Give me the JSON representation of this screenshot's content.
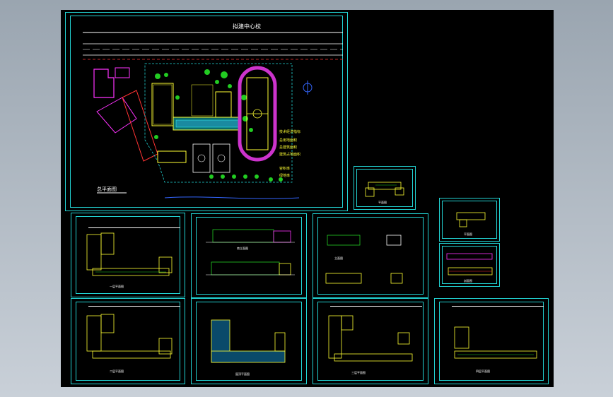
{
  "site_plan": {
    "title": "拟建中心校",
    "caption": "总平面图",
    "notes": [
      "技术经济指标",
      "总用地面积",
      "总建筑面积",
      "建筑占地面积",
      "容积率",
      "绿地率"
    ]
  },
  "sheets": [
    {
      "id": "first-floor-plan",
      "caption": "一层平面图"
    },
    {
      "id": "front-elevation",
      "caption": "南立面图"
    },
    {
      "id": "side-elevations",
      "caption": "立面图"
    },
    {
      "id": "small-plan-a",
      "caption": "平面图"
    },
    {
      "id": "small-plan-b",
      "caption": "平面图"
    },
    {
      "id": "small-section",
      "caption": "剖面图"
    },
    {
      "id": "second-floor-plan",
      "caption": "二层平面图"
    },
    {
      "id": "roof-plan",
      "caption": "屋顶平面图"
    },
    {
      "id": "third-floor-plan",
      "caption": "三层平面图"
    },
    {
      "id": "fourth-floor-plan",
      "caption": "四层平面图"
    }
  ],
  "colors": {
    "background": "#000000",
    "frame": "#22d3d3",
    "walls": "#ffff33",
    "greenery": "#22cc22",
    "road": "#ff3333",
    "magenta": "#ff33ff",
    "track": "#cc33cc"
  }
}
